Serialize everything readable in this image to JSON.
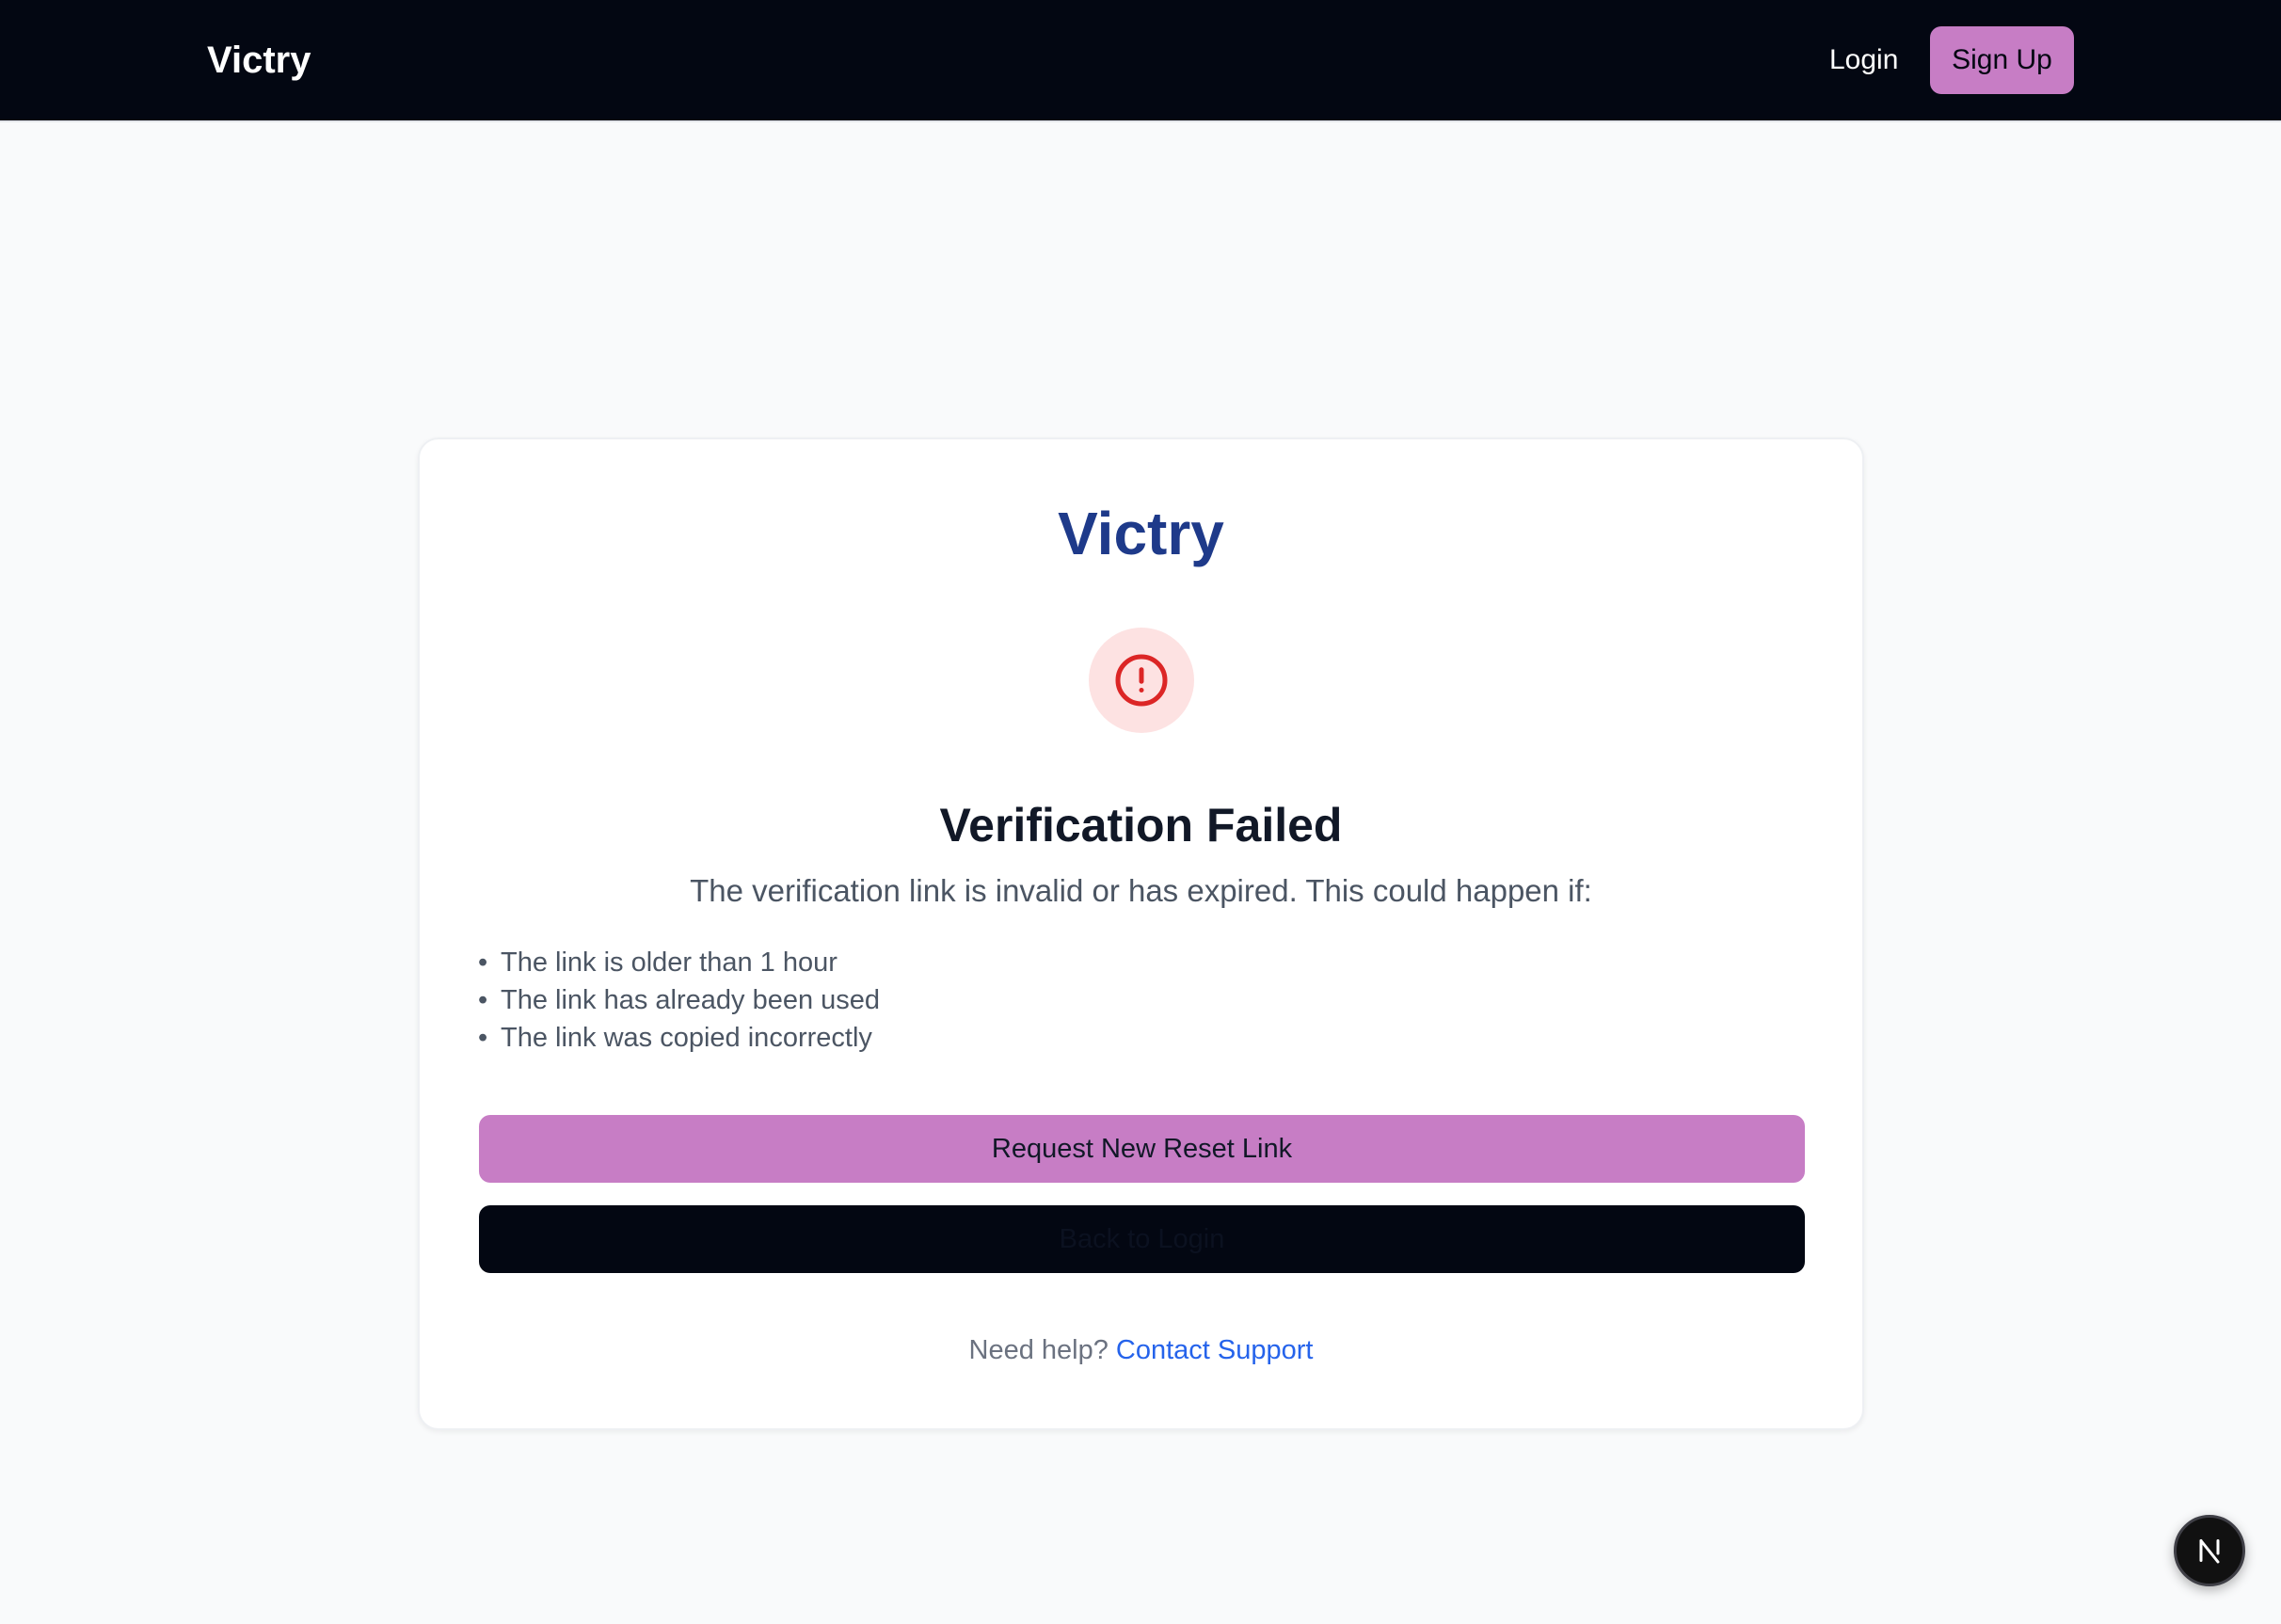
{
  "navbar": {
    "brand": "Victry",
    "login_label": "Login",
    "signup_label": "Sign Up"
  },
  "card": {
    "brand": "Victry",
    "icon": "alert-circle-icon",
    "title": "Verification Failed",
    "description": "The verification link is invalid or has expired. This could happen if:",
    "reasons": [
      "The link is older than 1 hour",
      "The link has already been used",
      "The link was copied incorrectly"
    ],
    "primary_button": "Request New Reset Link",
    "secondary_button": "Back to Login",
    "help_text": "Need help?",
    "help_link": "Contact Support"
  },
  "dev_badge": {
    "icon": "nextjs-logo-icon",
    "letter": "N"
  },
  "colors": {
    "accent": "#c77dc5",
    "navbar_bg": "#030712",
    "brand_text": "#1e3a8a",
    "error": "#dc2626",
    "error_bg": "#fde2e2",
    "link": "#2563eb"
  }
}
